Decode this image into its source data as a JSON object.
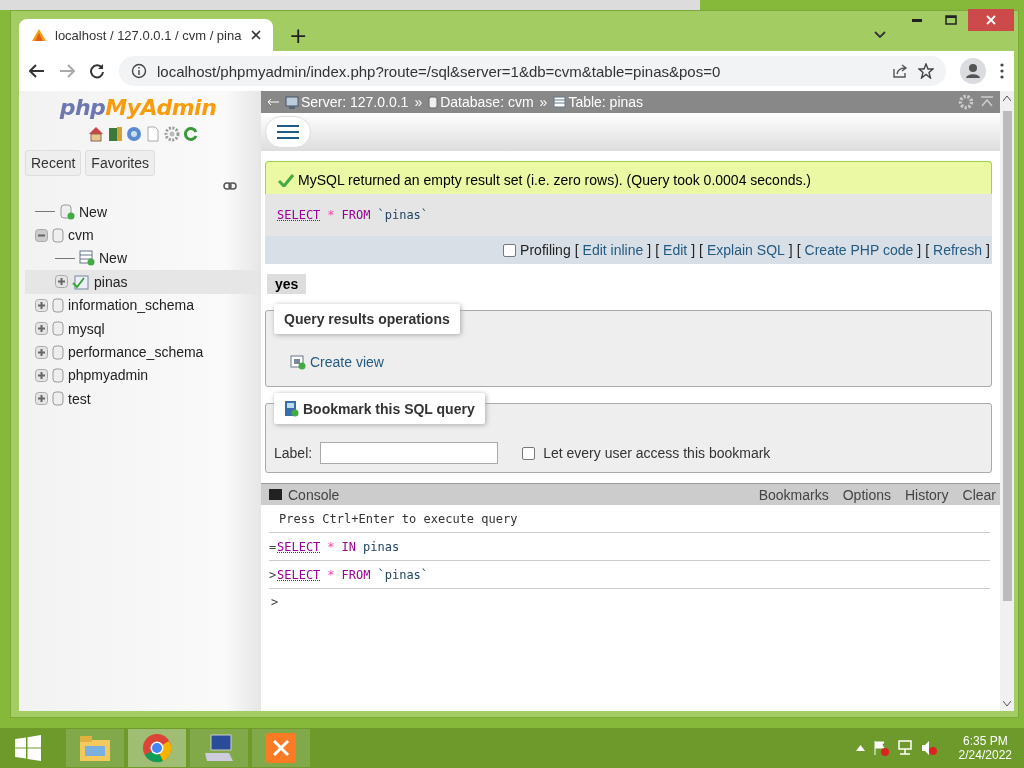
{
  "browser": {
    "tab_title": "localhost / 127.0.0.1 / cvm / pina",
    "new_tab": "+",
    "url": "localhost/phpmyadmin/index.php?route=/sql&server=1&db=cvm&table=pinas&pos=0"
  },
  "sidebar": {
    "logo": {
      "part_1": "php",
      "part_2": "MyAdmin"
    },
    "tabs": [
      {
        "label": "Recent",
        "selected": false
      },
      {
        "label": "Favorites",
        "selected": false
      }
    ],
    "tree": [
      {
        "label": "New",
        "kind": "new-db",
        "selected": false
      },
      {
        "label": "cvm",
        "kind": "db",
        "expanded": true,
        "selected": false,
        "children": [
          {
            "label": "New",
            "kind": "new-table",
            "selected": false
          },
          {
            "label": "pinas",
            "kind": "table",
            "expanded": false,
            "selected": true
          }
        ]
      },
      {
        "label": "information_schema",
        "kind": "db",
        "expanded": false,
        "selected": false
      },
      {
        "label": "mysql",
        "kind": "db",
        "expanded": false,
        "selected": false
      },
      {
        "label": "performance_schema",
        "kind": "db",
        "expanded": false,
        "selected": false
      },
      {
        "label": "phpmyadmin",
        "kind": "db",
        "expanded": false,
        "selected": false
      },
      {
        "label": "test",
        "kind": "db",
        "expanded": false,
        "selected": false
      }
    ]
  },
  "breadcrumb": [
    {
      "label": "Server: 127.0.0.1",
      "kind": "server"
    },
    {
      "label": "Database: cvm",
      "kind": "database"
    },
    {
      "label": "Table: pinas",
      "kind": "table"
    }
  ],
  "breadcrumb_separator": "»",
  "message": "MySQL returned an empty result set (i.e. zero rows). (Query took 0.0004 seconds.)",
  "query": [
    {
      "text": "SELECT",
      "kind": "keyword"
    },
    {
      "text": "*",
      "kind": "operator"
    },
    {
      "text": "FROM",
      "kind": "keyword"
    },
    {
      "text": "`pinas`",
      "kind": "identifier"
    }
  ],
  "profiling": {
    "label": "Profiling",
    "checked": false
  },
  "query_links": [
    "Edit inline",
    "Edit",
    "Explain SQL",
    "Create PHP code",
    "Refresh"
  ],
  "bracket_open": "[",
  "bracket_close": "]",
  "result_columns": [
    "yes"
  ],
  "operations": {
    "legend": "Query results operations",
    "link": "Create view"
  },
  "bookmark": {
    "legend": "Bookmark this SQL query",
    "label": "Label:",
    "share_label": "Let every user access this bookmark",
    "share_checked": false
  },
  "console": {
    "title": "Console",
    "actions": [
      "Bookmarks",
      "Options",
      "History",
      "Clear"
    ],
    "hint": "Press Ctrl+Enter to execute query",
    "lines": [
      {
        "prefix": "=",
        "tokens": [
          {
            "text": "SELECT",
            "kind": "keyword"
          },
          {
            "text": "*",
            "kind": "operator"
          },
          {
            "text": "IN",
            "kind": "keyword"
          },
          {
            "text": "pinas",
            "kind": "identifier"
          }
        ]
      },
      {
        "prefix": ">",
        "tokens": [
          {
            "text": "SELECT",
            "kind": "keyword"
          },
          {
            "text": "*",
            "kind": "operator"
          },
          {
            "text": "FROM",
            "kind": "keyword"
          },
          {
            "text": "`pinas`",
            "kind": "identifier"
          }
        ]
      }
    ],
    "prompt": ">"
  },
  "taskbar": {
    "apps": [
      {
        "kind": "explorer",
        "selected": false
      },
      {
        "kind": "chrome",
        "selected": true
      },
      {
        "kind": "network",
        "selected": false
      },
      {
        "kind": "xampp",
        "selected": false
      }
    ],
    "time": "6:35 PM",
    "date": "2/24/2022"
  }
}
